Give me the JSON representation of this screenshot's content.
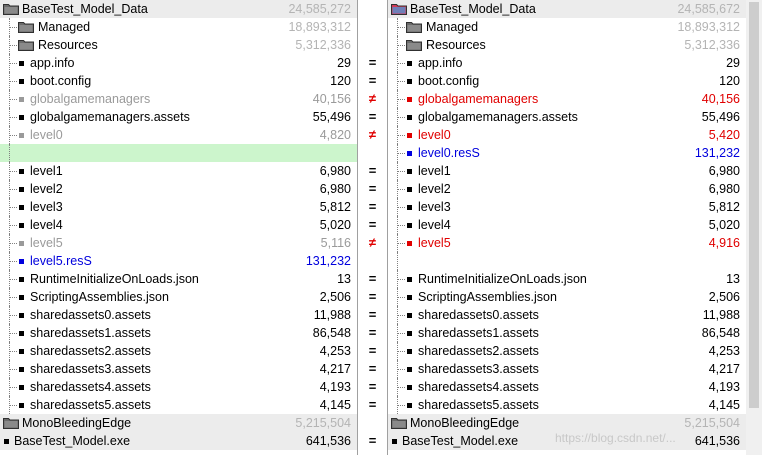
{
  "left": {
    "rows": [
      {
        "name": "BaseTest_Model_Data",
        "size": "24,585,272",
        "kind": "root-folder",
        "state": "dim",
        "root_icon": "folder-icon"
      },
      {
        "name": "Managed",
        "size": "18,893,312",
        "kind": "folder",
        "state": "dim"
      },
      {
        "name": "Resources",
        "size": "5,312,336",
        "kind": "folder",
        "state": "dim"
      },
      {
        "name": "app.info",
        "size": "29",
        "kind": "file",
        "state": "normal"
      },
      {
        "name": "boot.config",
        "size": "120",
        "kind": "file",
        "state": "normal"
      },
      {
        "name": "globalgamemanagers",
        "size": "40,156",
        "kind": "file",
        "state": "gray"
      },
      {
        "name": "globalgamemanagers.assets",
        "size": "55,496",
        "kind": "file",
        "state": "normal"
      },
      {
        "name": "level0",
        "size": "4,820",
        "kind": "file",
        "state": "gray"
      },
      {
        "name": "",
        "size": "",
        "kind": "blank",
        "state": "green"
      },
      {
        "name": "level1",
        "size": "6,980",
        "kind": "file",
        "state": "normal"
      },
      {
        "name": "level2",
        "size": "6,980",
        "kind": "file",
        "state": "normal"
      },
      {
        "name": "level3",
        "size": "5,812",
        "kind": "file",
        "state": "normal"
      },
      {
        "name": "level4",
        "size": "5,020",
        "kind": "file",
        "state": "normal"
      },
      {
        "name": "level5",
        "size": "5,116",
        "kind": "file",
        "state": "gray"
      },
      {
        "name": "level5.resS",
        "size": "131,232",
        "kind": "file",
        "state": "blue"
      },
      {
        "name": "RuntimeInitializeOnLoads.json",
        "size": "13",
        "kind": "file",
        "state": "normal"
      },
      {
        "name": "ScriptingAssemblies.json",
        "size": "2,506",
        "kind": "file",
        "state": "normal"
      },
      {
        "name": "sharedassets0.assets",
        "size": "11,988",
        "kind": "file",
        "state": "normal"
      },
      {
        "name": "sharedassets1.assets",
        "size": "86,548",
        "kind": "file",
        "state": "normal"
      },
      {
        "name": "sharedassets2.assets",
        "size": "4,253",
        "kind": "file",
        "state": "normal"
      },
      {
        "name": "sharedassets3.assets",
        "size": "4,217",
        "kind": "file",
        "state": "normal"
      },
      {
        "name": "sharedassets4.assets",
        "size": "4,193",
        "kind": "file",
        "state": "normal"
      },
      {
        "name": "sharedassets5.assets",
        "size": "4,145",
        "kind": "file",
        "state": "normal"
      },
      {
        "name": "MonoBleedingEdge",
        "size": "5,215,504",
        "kind": "top-folder",
        "state": "dim"
      },
      {
        "name": "BaseTest_Model.exe",
        "size": "641,536",
        "kind": "top-file",
        "state": "normal"
      }
    ]
  },
  "right": {
    "rows": [
      {
        "name": "BaseTest_Model_Data",
        "size": "24,585,672",
        "kind": "root-folder",
        "state": "dim",
        "root_icon": "folder-modified-icon"
      },
      {
        "name": "Managed",
        "size": "18,893,312",
        "kind": "folder",
        "state": "dim"
      },
      {
        "name": "Resources",
        "size": "5,312,336",
        "kind": "folder",
        "state": "dim"
      },
      {
        "name": "app.info",
        "size": "29",
        "kind": "file",
        "state": "normal"
      },
      {
        "name": "boot.config",
        "size": "120",
        "kind": "file",
        "state": "normal"
      },
      {
        "name": "globalgamemanagers",
        "size": "40,156",
        "kind": "file",
        "state": "red"
      },
      {
        "name": "globalgamemanagers.assets",
        "size": "55,496",
        "kind": "file",
        "state": "normal"
      },
      {
        "name": "level0",
        "size": "5,420",
        "kind": "file",
        "state": "red"
      },
      {
        "name": "level0.resS",
        "size": "131,232",
        "kind": "file",
        "state": "blue"
      },
      {
        "name": "level1",
        "size": "6,980",
        "kind": "file",
        "state": "normal"
      },
      {
        "name": "level2",
        "size": "6,980",
        "kind": "file",
        "state": "normal"
      },
      {
        "name": "level3",
        "size": "5,812",
        "kind": "file",
        "state": "normal"
      },
      {
        "name": "level4",
        "size": "5,020",
        "kind": "file",
        "state": "normal"
      },
      {
        "name": "level5",
        "size": "4,916",
        "kind": "file",
        "state": "red"
      },
      {
        "name": "",
        "size": "",
        "kind": "blank",
        "state": "white"
      },
      {
        "name": "RuntimeInitializeOnLoads.json",
        "size": "13",
        "kind": "file",
        "state": "normal"
      },
      {
        "name": "ScriptingAssemblies.json",
        "size": "2,506",
        "kind": "file",
        "state": "normal"
      },
      {
        "name": "sharedassets0.assets",
        "size": "11,988",
        "kind": "file",
        "state": "normal"
      },
      {
        "name": "sharedassets1.assets",
        "size": "86,548",
        "kind": "file",
        "state": "normal"
      },
      {
        "name": "sharedassets2.assets",
        "size": "4,253",
        "kind": "file",
        "state": "normal"
      },
      {
        "name": "sharedassets3.assets",
        "size": "4,217",
        "kind": "file",
        "state": "normal"
      },
      {
        "name": "sharedassets4.assets",
        "size": "4,193",
        "kind": "file",
        "state": "normal"
      },
      {
        "name": "sharedassets5.assets",
        "size": "4,145",
        "kind": "file",
        "state": "normal"
      },
      {
        "name": "MonoBleedingEdge",
        "size": "5,215,504",
        "kind": "top-folder",
        "state": "dim"
      },
      {
        "name": "BaseTest_Model.exe",
        "size": "641,536",
        "kind": "top-file",
        "state": "normal"
      }
    ]
  },
  "compare": [
    "",
    "",
    "",
    "=",
    "=",
    "≠",
    "=",
    "≠",
    "",
    "=",
    "=",
    "=",
    "=",
    "≠",
    "",
    "=",
    "=",
    "=",
    "=",
    "=",
    "=",
    "=",
    "=",
    "",
    "="
  ],
  "watermark": "https://blog.csdn.net/...",
  "colors": {
    "equal": "#000000",
    "different": "#e00000",
    "orphan": "#0000dd",
    "dim": "#9a9a9a",
    "blank_highlight": "#ccf5cc"
  }
}
